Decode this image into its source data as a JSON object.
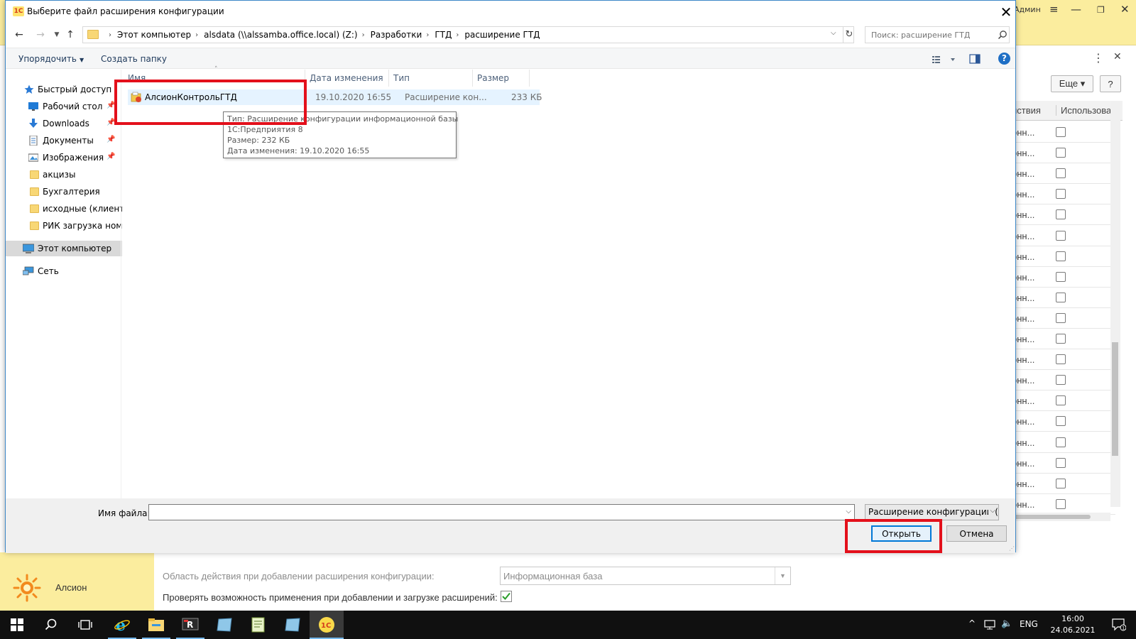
{
  "dialog": {
    "title": "Выберите файл расширения конфигурации",
    "close_label": "✕"
  },
  "address": {
    "crumbs": [
      "Этот компьютер",
      "alsdata (\\\\alssamba.office.local) (Z:)",
      "Разработки",
      "ГТД",
      "расширение ГТД"
    ]
  },
  "search": {
    "placeholder": "Поиск: расширение ГТД"
  },
  "toolbar": {
    "organize_label": "Упорядочить",
    "new_folder_label": "Создать папку",
    "help_label": "?"
  },
  "navpane": {
    "items": [
      {
        "label": "Быстрый доступ",
        "icon": "star-icon"
      },
      {
        "label": "Рабочий стол",
        "icon": "desktop-icon",
        "pinned": true
      },
      {
        "label": "Downloads",
        "icon": "download-icon",
        "pinned": true
      },
      {
        "label": "Документы",
        "icon": "documents-icon",
        "pinned": true
      },
      {
        "label": "Изображения",
        "icon": "pictures-icon",
        "pinned": true
      },
      {
        "label": "акцизы",
        "icon": "folder-icon"
      },
      {
        "label": "Бухгалтерия",
        "icon": "folder-icon"
      },
      {
        "label": "исходные (клиента",
        "icon": "folder-icon"
      },
      {
        "label": "РИК загрузка номе",
        "icon": "folder-icon"
      },
      {
        "label": "Этот компьютер",
        "icon": "computer-icon",
        "selected": true
      },
      {
        "label": "Сеть",
        "icon": "network-icon"
      }
    ]
  },
  "filelist": {
    "columns": [
      "Имя",
      "Дата изменения",
      "Тип",
      "Размер"
    ],
    "rows": [
      {
        "name": "АлсионКонтрольГТД",
        "date": "19.10.2020 16:55",
        "type": "Расширение кон...",
        "size": "233 КБ"
      }
    ]
  },
  "tooltip": {
    "lines": [
      "Тип: Расширение конфигурации информационной базы",
      "1С:Предприятия 8",
      "Размер: 232 КБ",
      "Дата изменения: 19.10.2020 16:55"
    ]
  },
  "footer": {
    "filename_label": "Имя файла:",
    "filename_value": "",
    "filter_value": "Расширение конфигурации (*",
    "open_label": "Открыть",
    "cancel_label": "Отмена"
  },
  "background": {
    "user_label": "Админ",
    "more_label": "Еще ▾",
    "help_label": "?",
    "col1": "йствия",
    "col2": "Использовать",
    "row_text": "онн...",
    "row_count": 19,
    "app_name": "Алсион",
    "scope_label": "Область действия при добавлении расширения конфигурации:",
    "scope_value": "Информационная база",
    "check_label": "Проверять возможность применения при добавлении и загрузке расширений:",
    "check_checked": true
  },
  "taskbar": {
    "time": "16:00",
    "date": "24.06.2021",
    "lang": "ENG",
    "notif_count": "1"
  },
  "colors": {
    "accent": "#0078d7",
    "annotation": "#e3101b",
    "app_yellow": "#fbed9e"
  }
}
